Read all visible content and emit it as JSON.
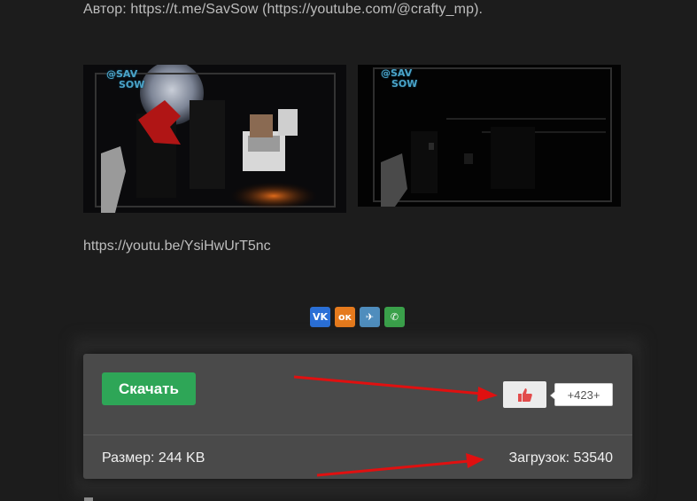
{
  "post": {
    "author_line": "Автор: https://t.me/SavSow (https://youtube.com/@crafty_mp).",
    "video_link": "https://youtu.be/YsiHwUrT5nc",
    "screenshots": [
      {
        "watermark_line1": "@SAV",
        "watermark_line2": "SOW"
      },
      {
        "watermark_line1": "@SAV",
        "watermark_line2": "SOW"
      }
    ]
  },
  "share": [
    {
      "icon": "vk-icon",
      "glyph": "VK",
      "color": "#2a6fd6"
    },
    {
      "icon": "odnoklassniki-icon",
      "glyph": "ок",
      "color": "#e57a1d"
    },
    {
      "icon": "telegram-icon",
      "glyph": "✈",
      "color": "#4f8dbd"
    },
    {
      "icon": "whatsapp-icon",
      "glyph": "✆",
      "color": "#3aa04a"
    }
  ],
  "download_panel": {
    "download_label": "Скачать",
    "like_count": "+423+",
    "size_text": "Размер: 244 KB",
    "downloads_text": "Загрузок: 53540"
  },
  "colors": {
    "background": "#1c1c1c",
    "panel": "#4a4a4a",
    "download_button": "#2ea657",
    "arrow": "#e01010",
    "like_icon": "#e24b4b"
  }
}
